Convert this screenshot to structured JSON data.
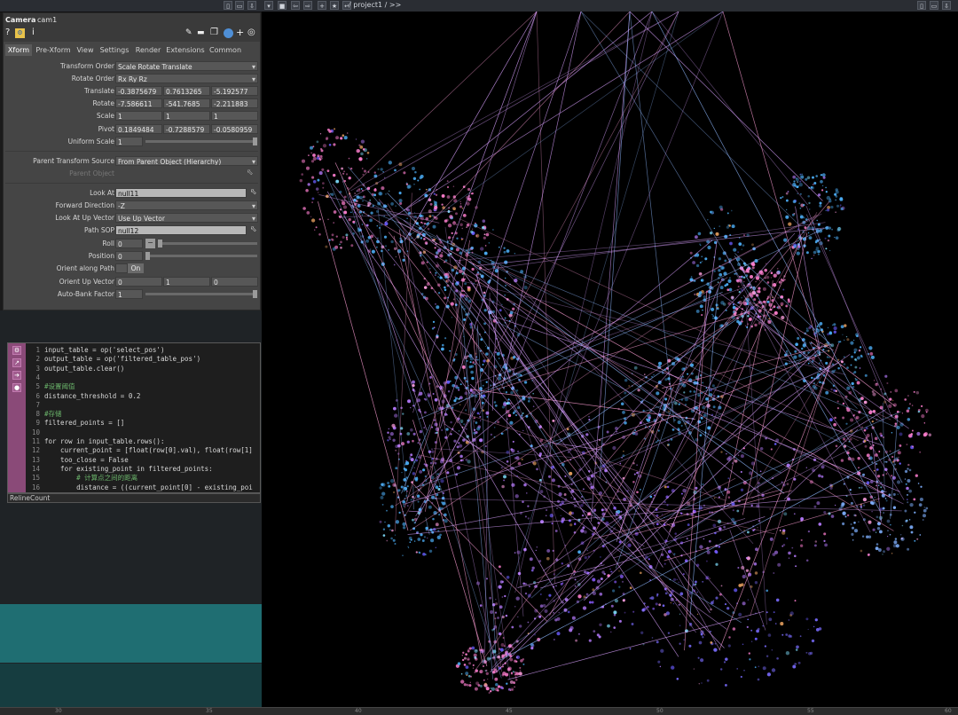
{
  "topbar": {
    "path": "/ project1 / >>"
  },
  "operator": {
    "type": "Camera",
    "name": "cam1",
    "header_icons": [
      "help-icon",
      "python-icon",
      "info-icon",
      "wrench-icon",
      "comment-icon",
      "copy-icon",
      "python-alt-icon",
      "add-icon",
      "target-icon"
    ],
    "help_glyph": "?",
    "info_glyph": "i"
  },
  "tabs": [
    "Xform",
    "Pre-Xform",
    "View",
    "Settings",
    "Render",
    "Extensions",
    "Common"
  ],
  "params": {
    "transform_order": {
      "label": "Transform Order",
      "value": "Scale Rotate Translate"
    },
    "rotate_order": {
      "label": "Rotate Order",
      "value": "Rx Ry Rz"
    },
    "translate": {
      "label": "Translate",
      "values": [
        "-0.3875679",
        "0.7613265",
        "-5.192577"
      ]
    },
    "rotate": {
      "label": "Rotate",
      "values": [
        "-7.586611",
        "-541.7685",
        "-2.211883"
      ]
    },
    "scale": {
      "label": "Scale",
      "values": [
        "1",
        "1",
        "1"
      ]
    },
    "pivot": {
      "label": "Pivot",
      "values": [
        "0.1849484",
        "-0.7288579",
        "-0.0580959"
      ]
    },
    "uniform_scale": {
      "label": "Uniform Scale",
      "value": "1"
    },
    "parent_transform_source": {
      "label": "Parent Transform Source",
      "value": "From Parent Object (Hierarchy)"
    },
    "parent_object": {
      "label": "Parent Object"
    },
    "look_at": {
      "label": "Look At",
      "value": "null11"
    },
    "forward_direction": {
      "label": "Forward Direction",
      "value": "-Z"
    },
    "look_at_up_vector": {
      "label": "Look At Up Vector",
      "value": "Use Up Vector"
    },
    "path_sop": {
      "label": "Path SOP",
      "value": "null12"
    },
    "roll": {
      "label": "Roll",
      "value": "0"
    },
    "position": {
      "label": "Position",
      "value": "0"
    },
    "orient_along_path": {
      "label": "Orient along Path",
      "value": "On"
    },
    "orient_up_vector": {
      "label": "Orient Up Vector",
      "values": [
        "0",
        "1",
        "0"
      ]
    },
    "auto_bank_factor": {
      "label": "Auto-Bank Factor",
      "value": "1"
    }
  },
  "code": {
    "lines": [
      {
        "n": "1",
        "t": "input_table = op('select_pos')"
      },
      {
        "n": "2",
        "t": "output_table = op('filtered_table_pos')"
      },
      {
        "n": "3",
        "t": "output_table.clear()"
      },
      {
        "n": "4",
        "t": ""
      },
      {
        "n": "5",
        "t": "#设置阈值"
      },
      {
        "n": "6",
        "t": "distance_threshold = 0.2"
      },
      {
        "n": "7",
        "t": ""
      },
      {
        "n": "8",
        "t": "#存储"
      },
      {
        "n": "9",
        "t": "filtered_points = []"
      },
      {
        "n": "10",
        "t": ""
      },
      {
        "n": "11",
        "t": "for row in input_table.rows():"
      },
      {
        "n": "12",
        "t": "    current_point = [float(row[0].val), float(row[1]"
      },
      {
        "n": "13",
        "t": "    too_close = False"
      },
      {
        "n": "14",
        "t": "    for existing_point in filtered_points:"
      },
      {
        "n": "15",
        "t": "        # 计算点之间的距离"
      },
      {
        "n": "16",
        "t": "        distance = ((current_point[0] - existing_poi"
      }
    ],
    "footer": "RelineCount"
  },
  "ruler": {
    "ticks": [
      "30",
      "35",
      "40",
      "45",
      "50",
      "55",
      "60"
    ]
  },
  "colors": {
    "panel_bg": "#454545",
    "code_sidebar": "#8a4a78",
    "teal": "#1f6e72",
    "viewer_bg": "#000000",
    "particle_pink": "#ff7fd0",
    "particle_cyan": "#4fb4ff"
  }
}
